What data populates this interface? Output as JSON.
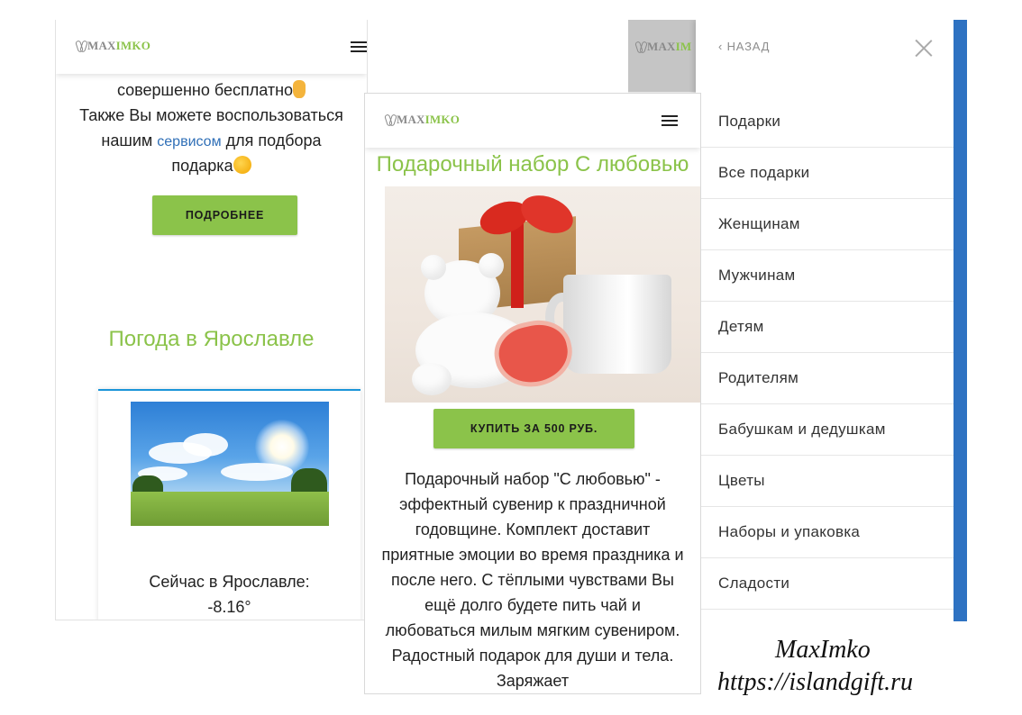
{
  "screen1": {
    "logo": {
      "grey": "MAX",
      "green": "IMKO"
    },
    "text_line1": "совершенно бесплатно",
    "text_line2": "Также Вы можете воспользоваться",
    "text_line3_before": "нашим",
    "text_line3_link": "сервисом",
    "text_line3_after": "для подбора",
    "text_line4": "подарка",
    "more_button": "ПОДРОБНЕЕ",
    "weather_title": "Погода в Ярославле",
    "weather_now": "Сейчас в Ярославле:",
    "weather_temp": "-8.16°"
  },
  "screen2": {
    "logo": {
      "grey": "MAX",
      "green": "IMKO"
    },
    "product_title": "Подарочный набор С любовью",
    "buy_button": "КУПИТЬ ЗА 500 РУБ.",
    "description": "Подарочный набор \"С любовью\" - эффектный сувенир к праздничной годовщине. Комплект доставит приятные эмоции во время праздника и после него. С тёплыми чувствами Вы ещё долго будете пить чай и любоваться милым мягким сувениром. Радостный подарок для души и тела. Заряжает"
  },
  "screen3": {
    "logo": {
      "grey": "MAX",
      "green": "IM"
    },
    "back_label": "НАЗАД",
    "menu_items": [
      "Подарки",
      "Все подарки",
      "Женщинам",
      "Мужчинам",
      "Детям",
      "Родителям",
      "Бабушкам и дедушкам",
      "Цветы",
      "Наборы и упаковка",
      "Сладости"
    ]
  },
  "caption": {
    "brand": "MaxImko",
    "url": "https://islandgift.ru"
  },
  "colors": {
    "accent_green": "#8bc34a",
    "link_blue": "#2f6fb7",
    "menu_blue": "#2e72c2",
    "weather_border": "#1a94d8"
  }
}
